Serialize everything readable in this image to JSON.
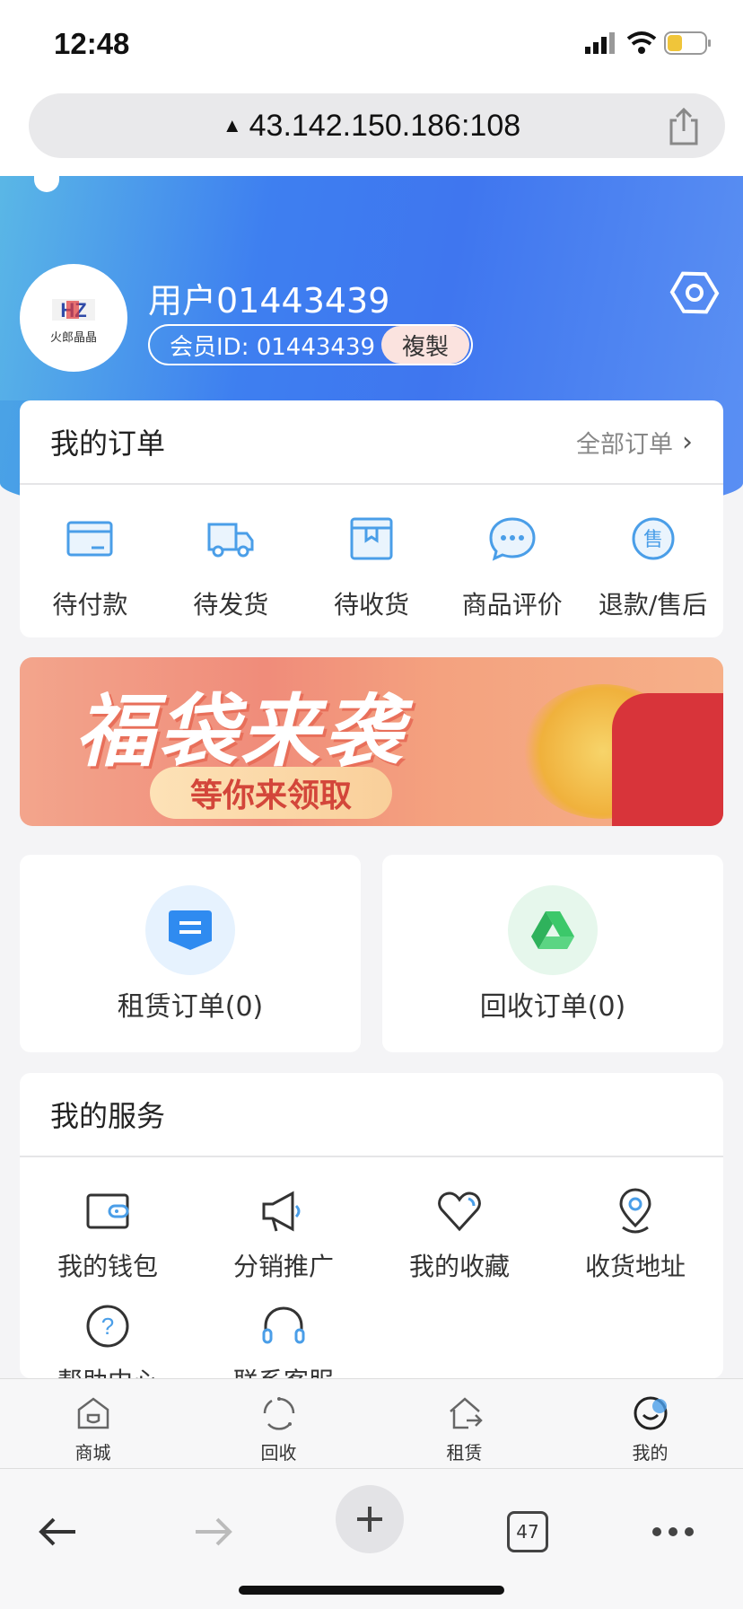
{
  "status_bar": {
    "time": "12:48"
  },
  "browser": {
    "url": "43.142.150.186:108",
    "tab_count": "47"
  },
  "profile": {
    "avatar_text": "火郎晶晶",
    "username": "用户01443439",
    "member_id": "会员ID: 01443439",
    "copy_label": "複製"
  },
  "orders": {
    "title": "我的订单",
    "all_label": "全部订单",
    "items": [
      {
        "label": "待付款",
        "icon": "card-icon"
      },
      {
        "label": "待发货",
        "icon": "truck-icon"
      },
      {
        "label": "待收货",
        "icon": "package-icon"
      },
      {
        "label": "商品评价",
        "icon": "chat-icon"
      },
      {
        "label": "退款/售后",
        "icon": "after-sale-icon"
      }
    ]
  },
  "banner": {
    "title": "福袋来袭",
    "subtitle": "等你来领取"
  },
  "rent_orders": {
    "label": "租赁订单(0)"
  },
  "recycle_orders": {
    "label": "回收订单(0)"
  },
  "services": {
    "title": "我的服务",
    "items": [
      {
        "label": "我的钱包",
        "icon": "wallet-icon"
      },
      {
        "label": "分销推广",
        "icon": "megaphone-icon"
      },
      {
        "label": "我的收藏",
        "icon": "heart-icon"
      },
      {
        "label": "收货地址",
        "icon": "location-icon"
      },
      {
        "label": "帮助中心",
        "icon": "help-icon"
      },
      {
        "label": "联系客服",
        "icon": "headset-icon"
      }
    ]
  },
  "tabbar": {
    "items": [
      {
        "label": "商城",
        "icon": "shop-icon"
      },
      {
        "label": "回收",
        "icon": "recycle-icon"
      },
      {
        "label": "租赁",
        "icon": "rent-icon"
      },
      {
        "label": "我的",
        "icon": "me-icon"
      }
    ]
  },
  "colors": {
    "accent": "#3e7ff0",
    "icon_blue": "#4a9ee8"
  }
}
